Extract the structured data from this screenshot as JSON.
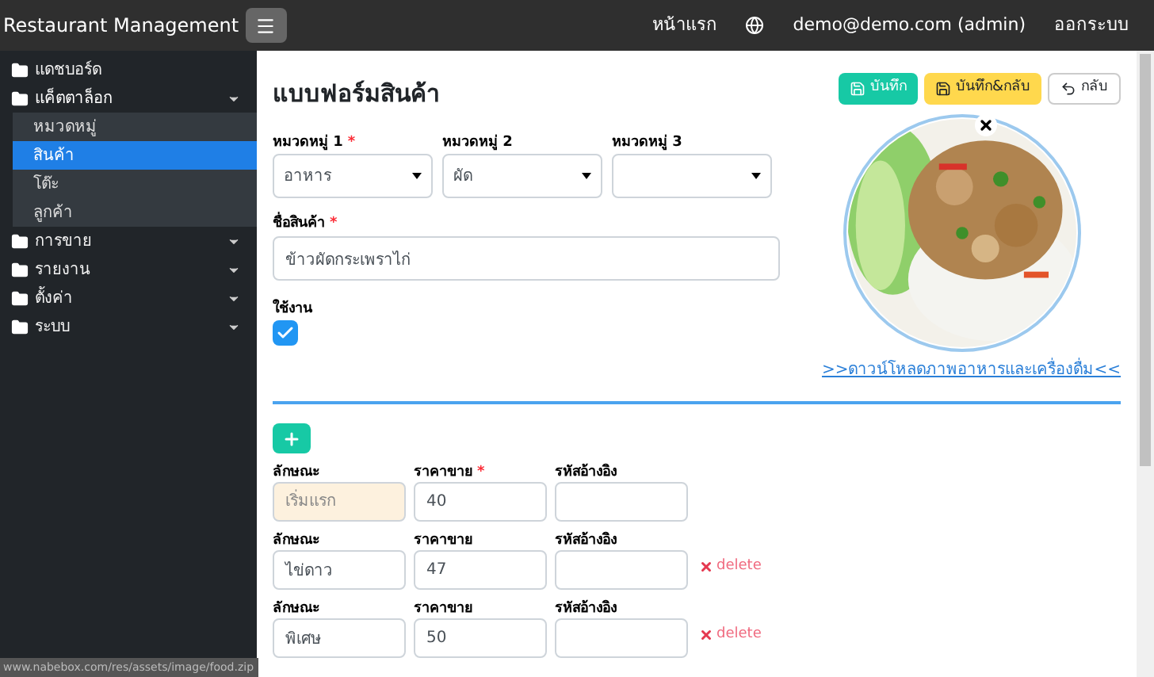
{
  "navbar": {
    "brand": "Restaurant Management",
    "links": [
      "หน้าแรก",
      "demo@demo.com (admin)",
      "ออกระบบ"
    ]
  },
  "sidebar": {
    "items": [
      {
        "label": "แดชบอร์ด",
        "kind": "link"
      },
      {
        "label": "แค็ตตาล็อก",
        "kind": "menu",
        "expanded": true,
        "children": [
          {
            "label": "หมวดหมู่",
            "selected": false
          },
          {
            "label": "สินค้า",
            "selected": true
          },
          {
            "label": "โต๊ะ",
            "selected": false
          },
          {
            "label": "ลูกค้า",
            "selected": false
          }
        ]
      },
      {
        "label": "การขาย",
        "kind": "menu",
        "expanded": false
      },
      {
        "label": "รายงาน",
        "kind": "menu",
        "expanded": false
      },
      {
        "label": "ตั้งค่า",
        "kind": "menu",
        "expanded": false
      },
      {
        "label": "ระบบ",
        "kind": "menu",
        "expanded": false
      }
    ]
  },
  "form": {
    "title": "แบบฟอร์มสินค้า",
    "buttons": [
      {
        "label": "บันทึก",
        "kind": "save"
      },
      {
        "label": "บันทึก&กลับ",
        "kind": "save-back"
      },
      {
        "label": "กลับ",
        "kind": "back"
      }
    ],
    "categories": [
      {
        "label": "หมวดหมู่ 1",
        "required_mark": "*",
        "value": "อาหาร"
      },
      {
        "label": "หมวดหมู่ 2",
        "value": "ผัด"
      },
      {
        "label": "หมวดหมู่ 3"
      }
    ],
    "name": {
      "label": "ชื่อสินค้า",
      "required_mark": "*",
      "value": "ข้าวผัดกระเพราไก่"
    },
    "active": {
      "label": "ใช้งาน",
      "checked": true
    },
    "image": {
      "download_link": ">>ดาวน์โหลดภาพอาหารและเครื่องดื่ม<<"
    },
    "variants": [
      {
        "feature_label": "ลักษณะ",
        "feature_placeholder": "เริ่มแรก",
        "price_label": "ราคาขาย",
        "price_required_mark": "*",
        "price": "40",
        "ref_label": "รหัสอ้างอิง"
      },
      {
        "feature_label": "ลักษณะ",
        "feature": "ไข่ดาว",
        "price_label": "ราคาขาย",
        "price": "47",
        "ref_label": "รหัสอ้างอิง",
        "delete": "delete"
      },
      {
        "feature_label": "ลักษณะ",
        "feature": "พิเศษ",
        "price_label": "ราคาขาย",
        "price": "50",
        "ref_label": "รหัสอ้างอิง",
        "delete": "delete"
      }
    ]
  },
  "status_bar": "www.nabebox.com/res/assets/image/food.zip"
}
